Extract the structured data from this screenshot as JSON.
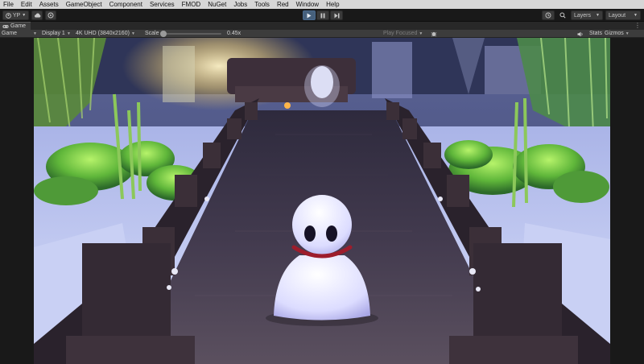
{
  "menu": [
    "File",
    "Edit",
    "Assets",
    "GameObject",
    "Component",
    "Services",
    "FMOD",
    "NuGet",
    "Jobs",
    "Tools",
    "Red",
    "Window",
    "Help"
  ],
  "toolbar": {
    "account_label": "YP",
    "layers_label": "Layers",
    "layout_label": "Layout"
  },
  "tab": {
    "label": "Game"
  },
  "game_toolbar": {
    "view_mode": "Game",
    "display": "Display 1",
    "resolution": "4K UHD (3840x2160)",
    "scale_label": "Scale",
    "scale_value": "0.45x",
    "play_focused": "Play Focused",
    "stats_label": "Stats",
    "gizmos_label": "Gizmos"
  },
  "colors": {
    "play_active": "#46607c",
    "menu_bg": "#d6d6d6",
    "editor_bg": "#191919",
    "panel_bg": "#3c3c3c"
  },
  "icons": [
    "account-icon",
    "cloud-icon",
    "collab-icon",
    "play-icon",
    "pause-icon",
    "step-icon",
    "history-icon",
    "search-icon",
    "bug-icon",
    "audio-icon",
    "tab-menu-icon"
  ]
}
